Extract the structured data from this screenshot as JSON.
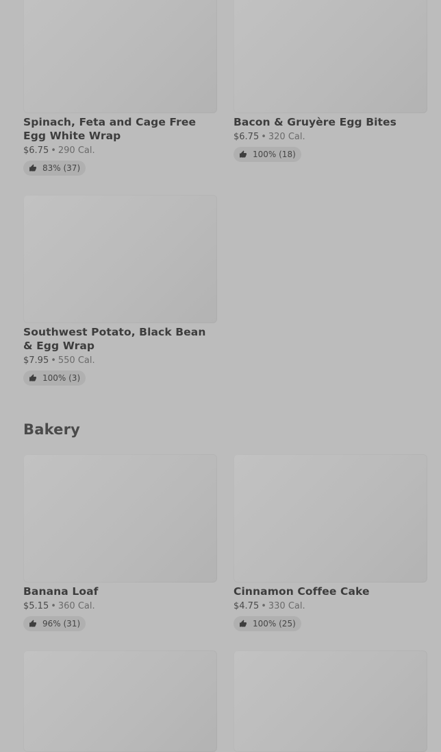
{
  "breakfast_items": [
    {
      "name": "Spinach, Feta and Cage Free Egg White Wrap",
      "price": "$6.75",
      "calories": "290 Cal.",
      "rating": "83% (37)"
    },
    {
      "name": "Bacon & Gruyère Egg Bites",
      "price": "$6.75",
      "calories": "320 Cal.",
      "rating": "100% (18)"
    },
    {
      "name": "Southwest Potato, Black Bean & Egg Wrap",
      "price": "$7.95",
      "calories": "550 Cal.",
      "rating": "100% (3)"
    }
  ],
  "bakery": {
    "title": "Bakery",
    "items": [
      {
        "name": "Banana Loaf",
        "price": "$5.15",
        "calories": "360 Cal.",
        "rating": "96% (31)"
      },
      {
        "name": "Cinnamon Coffee Cake",
        "price": "$4.75",
        "calories": "330 Cal.",
        "rating": "100% (25)"
      }
    ]
  },
  "separator": "•",
  "icons": {
    "rating": "thumbs-up-icon"
  }
}
